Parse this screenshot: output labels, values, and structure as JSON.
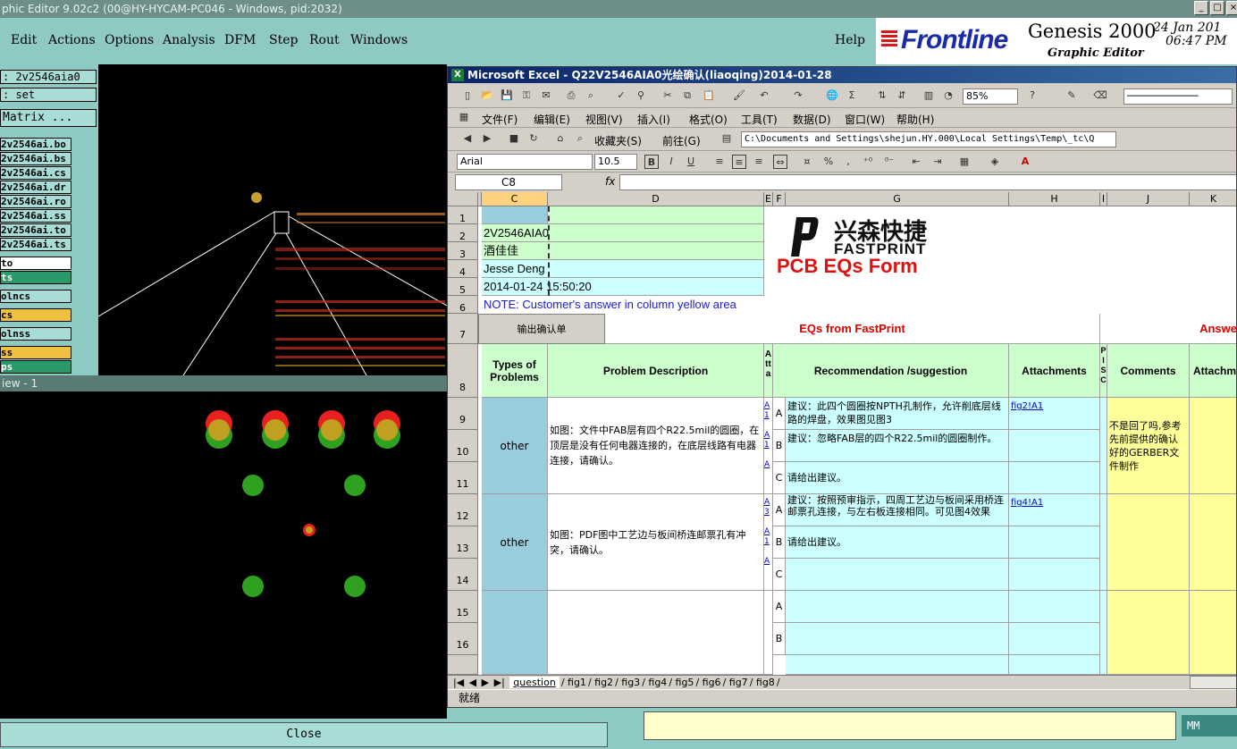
{
  "genesis": {
    "title": "phic Editor 9.02c2 (00@HY-HYCAM-PC046 - Windows, pid:2032)",
    "menu": [
      "Edit",
      "Actions",
      "Options",
      "Analysis",
      "DFM",
      "Step",
      "Rout",
      "Windows",
      "Help"
    ],
    "brand_logo": "Frontline",
    "brand_title": "Genesis 2000",
    "brand_subtitle": "Graphic Editor",
    "date": "24 Jan 201",
    "time": "06:47 PM",
    "job": ": 2v2546aia0",
    "step": ": set",
    "matrix_button": "Matrix ...",
    "files": [
      "2v2546ai.bo",
      "2v2546ai.bs",
      "2v2546ai.cs",
      "2v2546ai.dr",
      "2v2546ai.ro",
      "2v2546ai.ss",
      "2v2546ai.to",
      "2v2546ai.ts"
    ],
    "layers": [
      "to",
      "ts",
      "olncs",
      "cs",
      "olnss",
      "ss",
      "ps"
    ],
    "view2_title": "iew - 1",
    "close_label": "Close",
    "units": "MM"
  },
  "excel": {
    "title": "Microsoft Excel - Q22V2546AIA0光绘确认(liaoqing)2014-01-28",
    "menu": [
      "文件(F)",
      "编辑(E)",
      "视图(V)",
      "插入(I)",
      "格式(O)",
      "工具(T)",
      "数据(D)",
      "窗口(W)",
      "帮助(H)"
    ],
    "zoom": "85%",
    "favorites": "收藏夹(S)",
    "forward": "前往(G)",
    "path": "C:\\Documents and Settings\\shejun.HY.000\\Local Settings\\Temp\\_tc\\Q",
    "font": "Arial",
    "font_size": "10.5",
    "cell_ref": "C8",
    "fx": "fx",
    "columns": [
      "C",
      "D",
      "E",
      "F",
      "G",
      "H",
      "I",
      "J",
      "K"
    ],
    "rows": [
      "1",
      "2",
      "3",
      "4",
      "5",
      "6",
      "7",
      "8",
      "9",
      "10",
      "11",
      "12",
      "13",
      "14",
      "15",
      "16"
    ],
    "info": {
      "r2": "2V2546AIA0",
      "r3": "酒佳佳",
      "r4": "Jesse Deng",
      "r5": "2014-01-24  15:50:20",
      "note": "NOTE: Customer's  answer in column yellow area"
    },
    "logo_cn": "兴森快捷",
    "logo_en": "FASTPRINT",
    "form_title": "PCB EQs Form",
    "export_button": "输出确认单",
    "eqs_header": "EQs from FastPrint",
    "answer_header": "Answe",
    "headers": {
      "types": "Types of Problems",
      "desc": "Problem Description",
      "att": "Atta",
      "rec": "Recommendation /suggestion",
      "attach": "Attachments",
      "pis": "PISC",
      "comments": "Comments",
      "attach2": "Attachme"
    },
    "eq1": {
      "type": "other",
      "desc": "如图：文件中FAB层有四个R22.5mil的圆圈，在顶层是没有任何电器连接的，在底层线路有电器连接，请确认。",
      "a": "建议：此四个圆圈按NPTH孔制作，允许削底层线路的焊盘，效果图见图3",
      "b": "建议：忽略FAB层的四个R22.5mil的圆圈制作。",
      "c": "请给出建议。",
      "link": "fig2!A1",
      "comment": "不是回了吗,参考先前提供的确认好的GERBER文件制作"
    },
    "eq2": {
      "type": "other",
      "desc": "如图：PDF图中工艺边与板间桥连邮票孔有冲突，请确认。",
      "a": "建议：按照预审指示，四周工艺边与板间采用桥连邮票孔连接，与左右板连接相同。可见图4效果",
      "b": "请给出建议。",
      "link": "fig4!A1"
    },
    "options": [
      "A",
      "B",
      "C"
    ],
    "sheets": [
      "question",
      "fig1",
      "fig2",
      "fig3",
      "fig4",
      "fig5",
      "fig6",
      "fig7",
      "fig8"
    ],
    "status": "就绪"
  }
}
